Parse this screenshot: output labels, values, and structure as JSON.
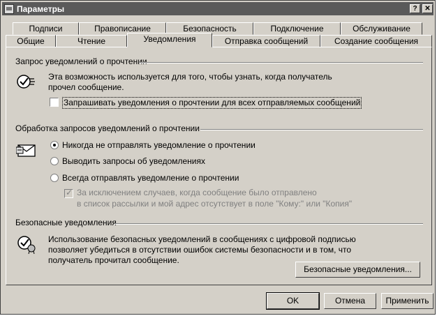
{
  "window": {
    "title": "Параметры",
    "help_btn": "?",
    "close_btn": "✕"
  },
  "tabs_top": [
    "Подписи",
    "Правописание",
    "Безопасность",
    "Подключение",
    "Обслуживание"
  ],
  "tabs_bottom": [
    "Общие",
    "Чтение",
    "Уведомления",
    "Отправка сообщений",
    "Создание сообщения"
  ],
  "active_tab": "Уведомления",
  "read_receipts": {
    "title": "Запрос уведомлений о прочтении",
    "description": "Эта возможность используется для того, чтобы узнать, когда получатель прочел сообщение.",
    "checkbox_label": "Запрашивать уведомления о прочтении для всех отправляемых сообщений",
    "checked": false
  },
  "handling": {
    "title": "Обработка запросов уведомлений о прочтении",
    "options": [
      {
        "label": "Никогда не отправлять уведомление о прочтении",
        "selected": true
      },
      {
        "label": "Выводить запросы об уведомлениях",
        "selected": false
      },
      {
        "label": "Всегда отправлять уведомление о прочтении",
        "selected": false
      }
    ],
    "exception_line1": "За исключением случаев, когда сообщение было отправлено",
    "exception_line2": "в список рассылки и мой адрес отсутствует в поле \"Кому:\" или \"Копия\"",
    "exception_checked": true
  },
  "secure": {
    "title": "Безопасные уведомления",
    "description": "Использование безопасных уведомлений в сообщениях с цифровой подписью позволяет убедиться в отсутствии ошибок системы безопасности и в том, что получатель прочитал сообщение.",
    "button": "Безопасные уведомления..."
  },
  "buttons": {
    "ok": "OK",
    "cancel": "Отмена",
    "apply": "Применить"
  }
}
